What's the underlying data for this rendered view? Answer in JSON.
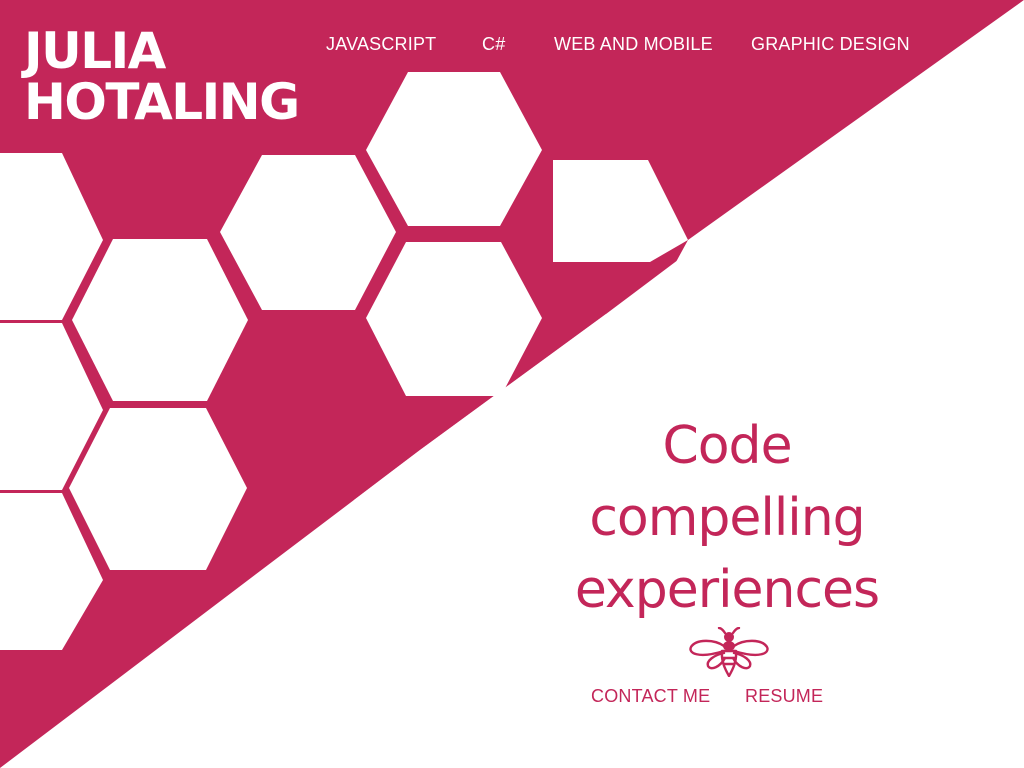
{
  "brand": {
    "line1": "JULIA",
    "line2": "HOTALING"
  },
  "nav": {
    "items": [
      {
        "label": "JAVASCRIPT"
      },
      {
        "label": "C#"
      },
      {
        "label": "WEB AND MOBILE"
      },
      {
        "label": "GRAPHIC DESIGN"
      }
    ]
  },
  "hero": {
    "lines": [
      "Code",
      "compelling",
      "experiences"
    ]
  },
  "logo_icon": "bee-icon",
  "cta": {
    "contact_label": "CONTACT ME",
    "resume_label": "RESUME"
  },
  "colors": {
    "accent": "#c32659",
    "background": "#ffffff",
    "on_accent_text": "#ffffff"
  }
}
